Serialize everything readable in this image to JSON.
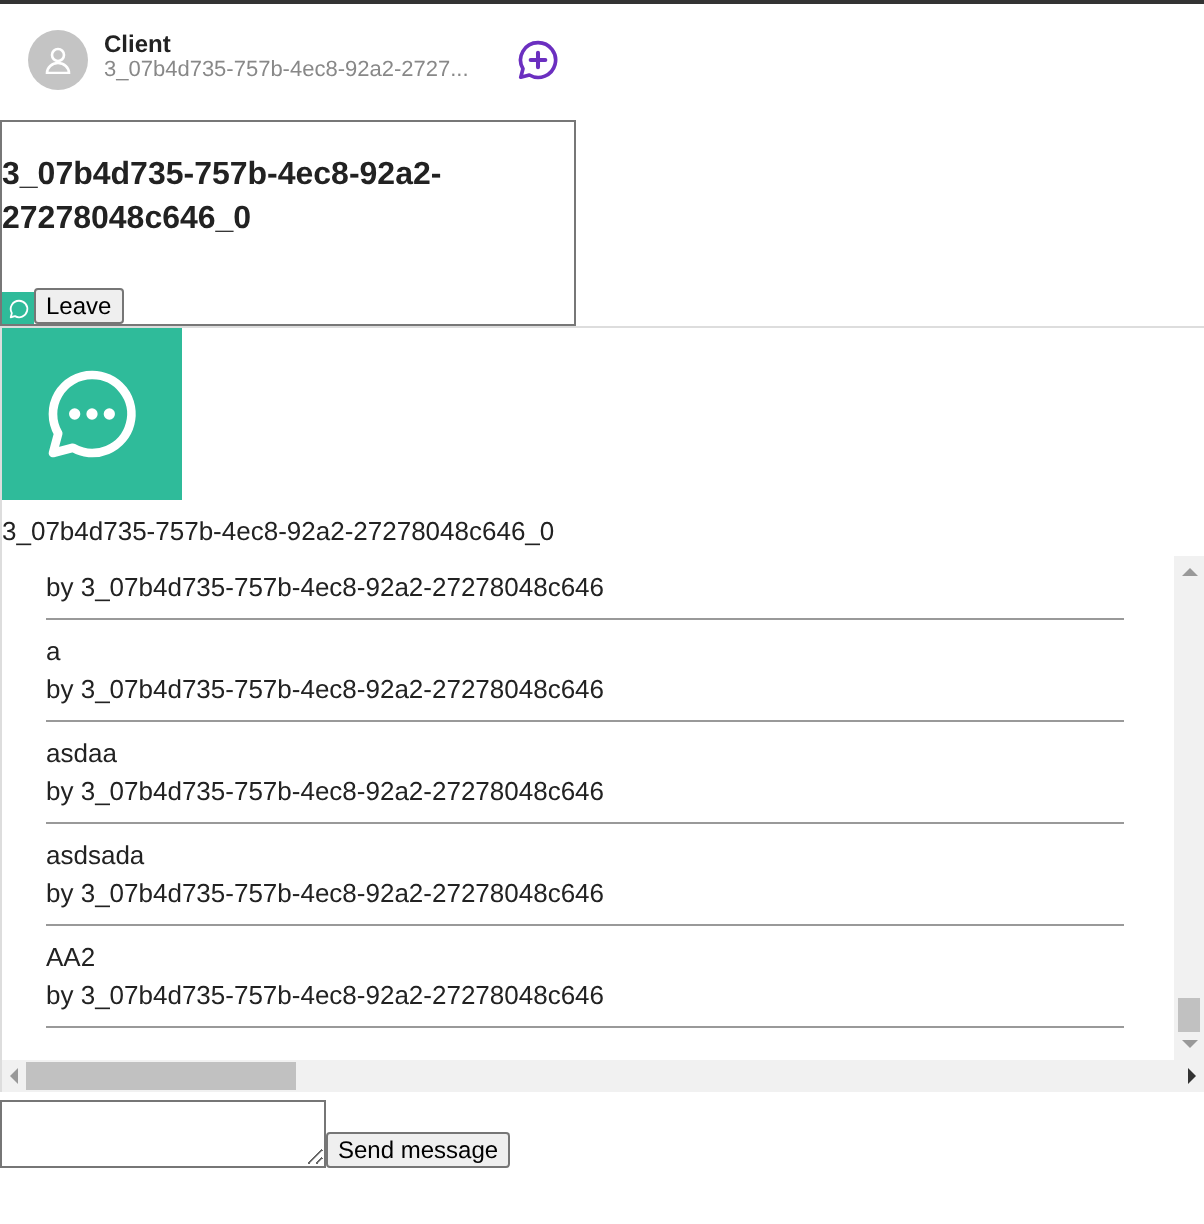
{
  "header": {
    "name": "Client",
    "subtitle": "3_07b4d735-757b-4ec8-92a2-2727..."
  },
  "channel_card": {
    "title": "3_07b4d735-757b-4ec8-92a2-27278048c646_0",
    "leave_button": "Leave"
  },
  "channel_panel": {
    "title": "3_07b4d735-757b-4ec8-92a2-27278048c646_0",
    "messages": [
      {
        "author": "by 3_07b4d735-757b-4ec8-92a2-27278048c646"
      },
      {
        "text": "a",
        "author": "by 3_07b4d735-757b-4ec8-92a2-27278048c646"
      },
      {
        "text": "asdaa",
        "author": "by 3_07b4d735-757b-4ec8-92a2-27278048c646"
      },
      {
        "text": "asdsada",
        "author": "by 3_07b4d735-757b-4ec8-92a2-27278048c646"
      },
      {
        "text": "AA2",
        "author": "by 3_07b4d735-757b-4ec8-92a2-27278048c646"
      }
    ]
  },
  "composer": {
    "send_button": "Send message"
  }
}
